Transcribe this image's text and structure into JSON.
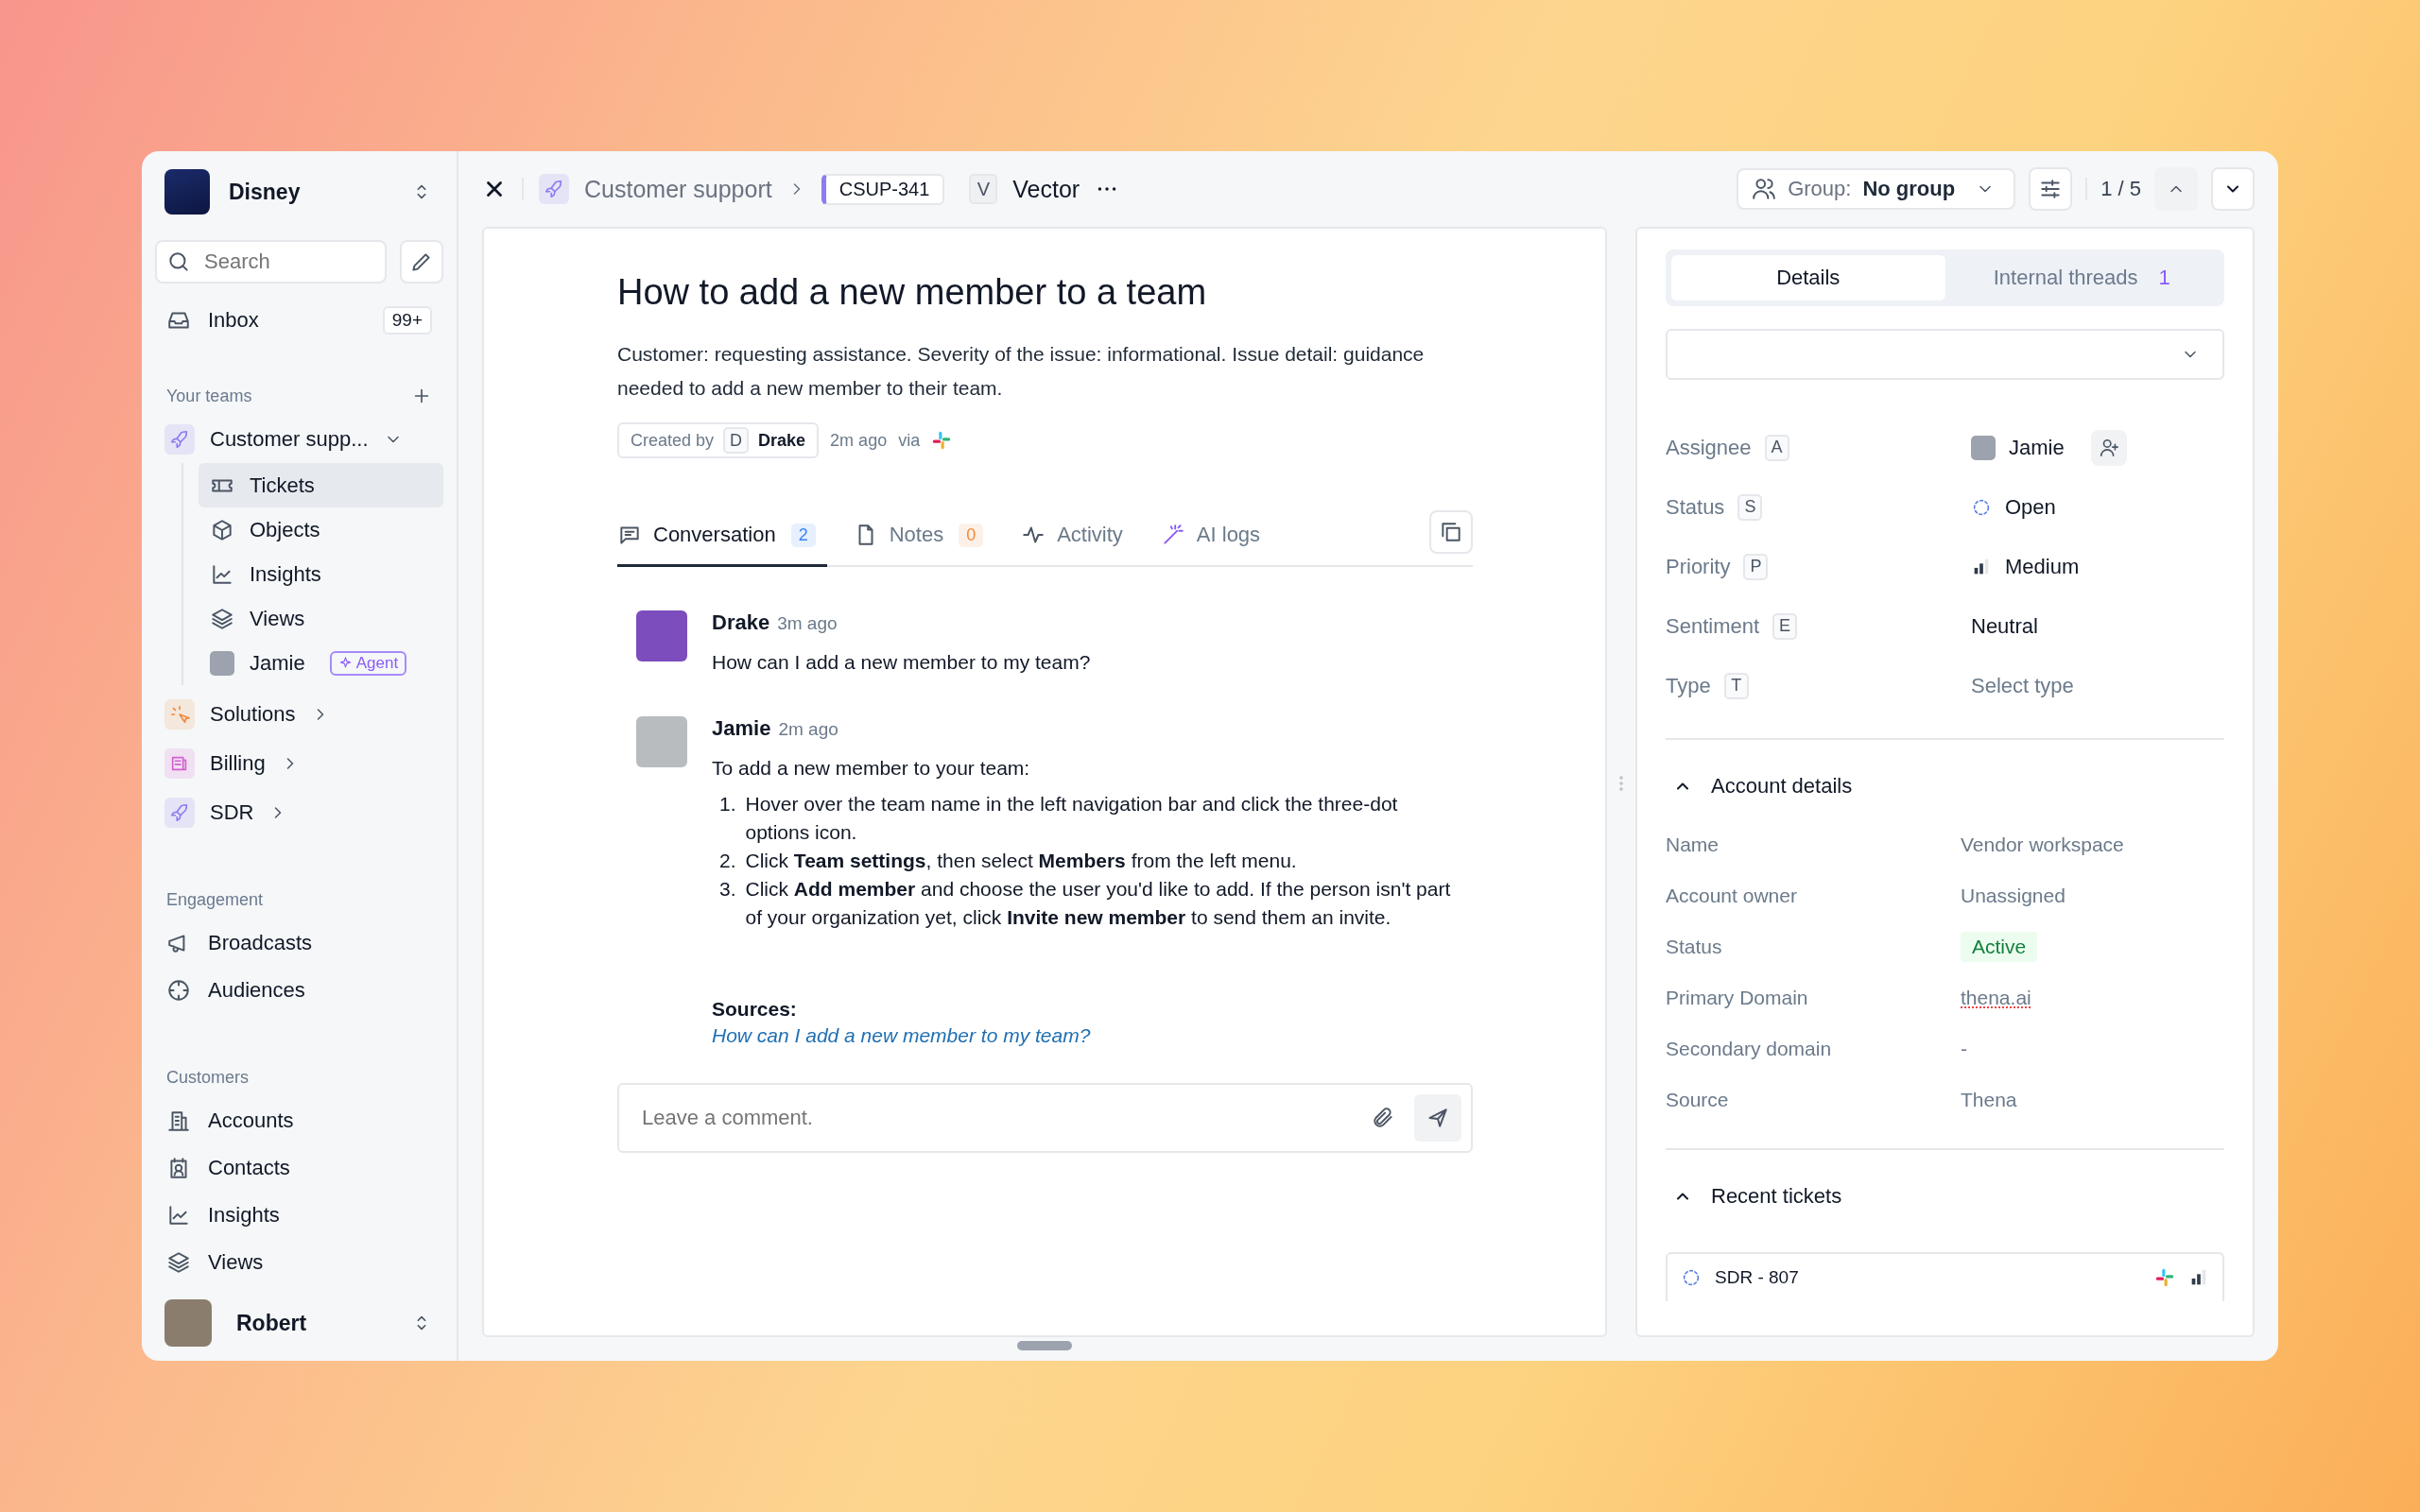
{
  "sidebar": {
    "workspace": {
      "name": "Disney"
    },
    "search": {
      "placeholder": "Search"
    },
    "inbox": {
      "label": "Inbox",
      "count": "99+"
    },
    "teams_heading": "Your teams",
    "teams": [
      {
        "name": "Customer supp...",
        "color": "#8b7cf0",
        "expanded": true,
        "children": [
          {
            "label": "Tickets",
            "selected": true,
            "kind": "page"
          },
          {
            "label": "Objects",
            "selected": false,
            "kind": "page"
          },
          {
            "label": "Insights",
            "selected": false,
            "kind": "page"
          },
          {
            "label": "Views",
            "selected": false,
            "kind": "page"
          },
          {
            "label": "Jamie",
            "selected": false,
            "kind": "agent",
            "badge": "Agent"
          }
        ]
      },
      {
        "name": "Solutions",
        "color": "#f08a3c",
        "expanded": false
      },
      {
        "name": "Billing",
        "color": "#d45fd0",
        "expanded": false
      },
      {
        "name": "SDR",
        "color": "#8b7cf0",
        "expanded": false
      }
    ],
    "sections": [
      {
        "heading": "Engagement",
        "items": [
          {
            "label": "Broadcasts",
            "selected": false
          },
          {
            "label": "Audiences",
            "selected": false
          }
        ]
      },
      {
        "heading": "Customers",
        "items": [
          {
            "label": "Accounts",
            "selected": false
          },
          {
            "label": "Contacts",
            "selected": false
          },
          {
            "label": "Insights",
            "selected": false
          },
          {
            "label": "Views",
            "selected": false
          }
        ]
      }
    ],
    "user": {
      "name": "Robert"
    }
  },
  "header": {
    "team": "Customer support",
    "ticket_id": "CSUP-341",
    "project_key": "V",
    "project": "Vector",
    "group_label": "Group:",
    "group_value": "No group",
    "pager": "1 / 5"
  },
  "ticket": {
    "title": "How to add a new member to a team",
    "description": "Customer: requesting assistance. Severity of the issue: informational. Issue detail: guidance needed to add a new member to their team.",
    "meta": {
      "created_label": "Created by",
      "creator_initial": "D",
      "creator": "Drake",
      "time": "2m ago",
      "via": "via"
    },
    "tabs": [
      {
        "label": "Conversation",
        "count": "2",
        "color": "#3b82f6",
        "selected": true
      },
      {
        "label": "Notes",
        "count": "0",
        "color": "#f08a3c",
        "selected": false
      },
      {
        "label": "Activity",
        "selected": false
      },
      {
        "label": "AI logs",
        "selected": false
      }
    ],
    "messages": [
      {
        "author": "Drake",
        "time": "3m ago",
        "kind": "plain",
        "text": "How can I add a new member to my team?"
      },
      {
        "author": "Jamie",
        "time": "2m ago",
        "kind": "steps",
        "intro": "To add a new member to your team:",
        "steps": [
          {
            "number": "1.",
            "text": "Hover over the team name in the left navigation bar and click the three-dot options icon."
          },
          {
            "number": "2.",
            "text": "Click **Team settings**, then select **Members** from the left menu."
          },
          {
            "number": "3.",
            "text": "Click **Add member** and choose the user you'd like to add. If the person isn't part of your organization yet, click **Invite new member** to send them an invite."
          }
        ],
        "sources_label": "Sources:",
        "source_link": "How can I add a new member to my team?"
      }
    ],
    "comment": {
      "placeholder": "Leave a comment."
    }
  },
  "details": {
    "tabs": [
      {
        "label": "Details",
        "selected": true
      },
      {
        "label": "Internal threads",
        "count": "1",
        "selected": false
      }
    ],
    "fields": [
      {
        "label": "Assignee",
        "key": "A",
        "value": "Jamie",
        "kind": "person"
      },
      {
        "label": "Status",
        "key": "S",
        "value": "Open",
        "kind": "status"
      },
      {
        "label": "Priority",
        "key": "P",
        "value": "Medium",
        "kind": "priority"
      },
      {
        "label": "Sentiment",
        "key": "E",
        "value": "Neutral",
        "kind": "text"
      },
      {
        "label": "Type",
        "key": "T",
        "value": "Select type",
        "kind": "placeholder"
      }
    ],
    "account": {
      "title": "Account details",
      "expanded": true,
      "rows": [
        {
          "label": "Name",
          "value": "Vendor workspace",
          "kind": "text"
        },
        {
          "label": "Account owner",
          "value": "Unassigned",
          "kind": "text"
        },
        {
          "label": "Status",
          "value": "Active",
          "kind": "badge"
        },
        {
          "label": "Primary Domain",
          "value": "thena.ai",
          "kind": "link"
        },
        {
          "label": "Secondary domain",
          "value": "-",
          "kind": "text"
        },
        {
          "label": "Source",
          "value": "Thena",
          "kind": "text"
        }
      ]
    },
    "recent": {
      "title": "Recent tickets",
      "expanded": true,
      "tickets": [
        {
          "id": "SDR - 807"
        }
      ]
    }
  }
}
